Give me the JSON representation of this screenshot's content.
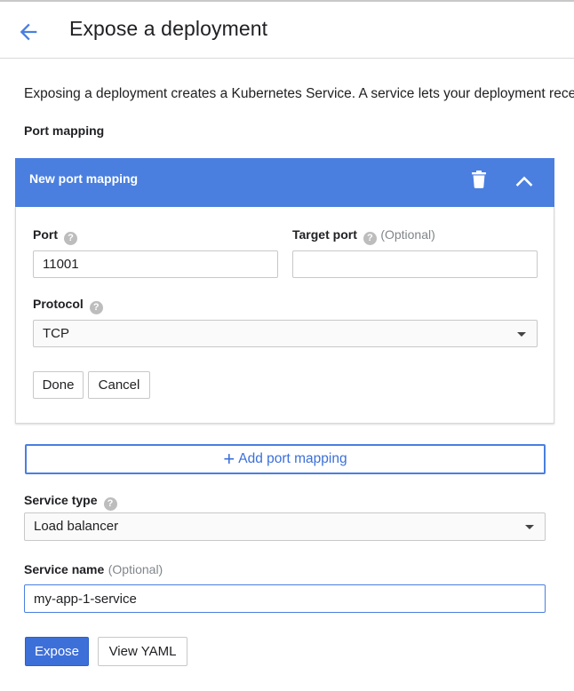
{
  "header": {
    "title": "Expose a deployment"
  },
  "intro_text": "Exposing a deployment creates a Kubernetes Service. A service lets your deployment receive traffic and defines how it is exposed.",
  "port_mapping": {
    "section_label": "Port mapping",
    "panel_title": "New port mapping",
    "port_label": "Port",
    "port_value": "11001",
    "target_port_label": "Target port",
    "target_port_optional": "(Optional)",
    "target_port_value": "",
    "protocol_label": "Protocol",
    "protocol_value": "TCP",
    "done_label": "Done",
    "cancel_label": "Cancel"
  },
  "add_port_mapping_label": "Add port mapping",
  "service_type": {
    "label": "Service type",
    "value": "Load balancer"
  },
  "service_name": {
    "label": "Service name",
    "optional": "(Optional)",
    "value": "my-app-1-service"
  },
  "actions": {
    "expose_label": "Expose",
    "view_yaml_label": "View YAML"
  },
  "colors": {
    "accent": "#4a7fe0",
    "primary_button": "#3d6fd8",
    "back_arrow": "#4a7fe0"
  },
  "help_glyph": "?",
  "plus_glyph": "+"
}
